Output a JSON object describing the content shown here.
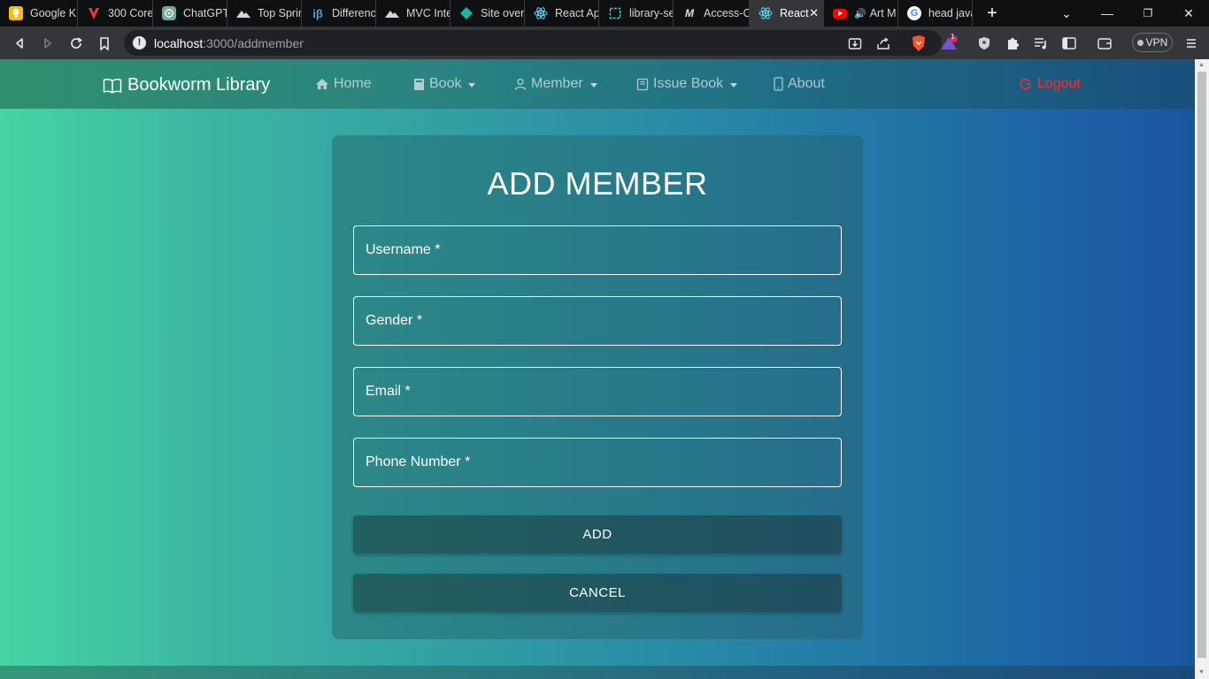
{
  "browser": {
    "tabs": [
      {
        "title": "Google K",
        "icon": "keep-icon",
        "color": "#fbbc04"
      },
      {
        "title": "300 Core",
        "icon": "v-logo-icon",
        "color": "#e53935"
      },
      {
        "title": "ChatGPT",
        "icon": "chatgpt-icon",
        "color": "#74aa9c"
      },
      {
        "title": "Top Sprin",
        "icon": "mountain-icon",
        "color": "#cfd8dc"
      },
      {
        "title": "Differenc",
        "icon": "ib-icon",
        "color": "#4fa3d9"
      },
      {
        "title": "MVC Inte",
        "icon": "mountain-icon",
        "color": "#cfd8dc"
      },
      {
        "title": "Site over",
        "icon": "diamond-icon",
        "color": "#14b8a6"
      },
      {
        "title": "React Ap",
        "icon": "react-icon",
        "color": "#61dafb"
      },
      {
        "title": "library-se",
        "icon": "code-icon",
        "color": "#3dd6c3"
      },
      {
        "title": "Access-C",
        "icon": "m-logo-icon",
        "color": "#e0e0e0"
      },
      {
        "title": "React",
        "icon": "react-icon",
        "color": "#61dafb",
        "active": true
      },
      {
        "title": "Art M",
        "icon": "youtube-icon",
        "color": "#ff0000",
        "audio": true
      },
      {
        "title": "head java",
        "icon": "google-icon",
        "color": "#4285f4"
      }
    ],
    "url_host": "localhost",
    "url_path": ":3000/addmember",
    "vpn_label": "VPN",
    "notification_count": "1"
  },
  "navbar": {
    "brand": "Bookworm Library",
    "items": [
      {
        "label": "Home",
        "icon": "home-icon"
      },
      {
        "label": "Book",
        "icon": "book-icon",
        "dropdown": true
      },
      {
        "label": "Member",
        "icon": "user-icon",
        "dropdown": true
      },
      {
        "label": "Issue Book",
        "icon": "issue-book-icon",
        "dropdown": true
      },
      {
        "label": "About",
        "icon": "phone-icon"
      }
    ],
    "logout": "Logout"
  },
  "form": {
    "title": "ADD MEMBER",
    "fields": [
      {
        "placeholder": "Username *",
        "value": ""
      },
      {
        "placeholder": "Gender *",
        "value": ""
      },
      {
        "placeholder": "Email *",
        "value": ""
      },
      {
        "placeholder": "Phone Number *",
        "value": ""
      }
    ],
    "add_label": "ADD",
    "cancel_label": "CANCEL"
  },
  "colors": {
    "gradient_start": "#45d4a3",
    "gradient_end": "#1a56a0",
    "logout": "#ff2a2a",
    "button": "#225f5f"
  }
}
